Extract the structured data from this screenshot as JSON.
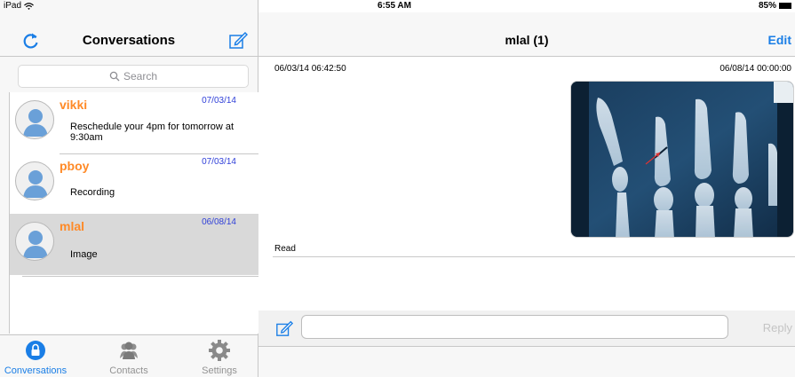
{
  "status_bar": {
    "device": "iPad",
    "time": "6:55 AM",
    "battery": "85%"
  },
  "left_nav": {
    "title": "Conversations"
  },
  "search": {
    "placeholder": "Search"
  },
  "conversations": [
    {
      "name": "vikki",
      "date": "07/03/14",
      "message": "Reschedule your 4pm for tomorrow at 9:30am",
      "selected": false
    },
    {
      "name": "pboy",
      "date": "07/03/14",
      "message": "Recording",
      "selected": false
    },
    {
      "name": "mlal",
      "date": "06/08/14",
      "message": "Image",
      "selected": true
    }
  ],
  "tabs": [
    {
      "label": "Conversations",
      "icon": "lock-icon",
      "active": true
    },
    {
      "label": "Contacts",
      "icon": "contacts-icon",
      "active": false
    },
    {
      "label": "Settings",
      "icon": "gear-icon",
      "active": false
    }
  ],
  "chat": {
    "title": "mlal (1)",
    "edit_label": "Edit",
    "timestamp_left": "06/03/14 06:42:50",
    "timestamp_right": "06/08/14 00:00:00",
    "read_label": "Read",
    "attachment": "hand x-ray image"
  },
  "reply": {
    "value": "",
    "button_label": "Reply"
  },
  "colors": {
    "accent": "#1a7ee6",
    "name": "#ff8a27",
    "date": "#2f3fd8",
    "selected_row": "#d9d9d9"
  }
}
